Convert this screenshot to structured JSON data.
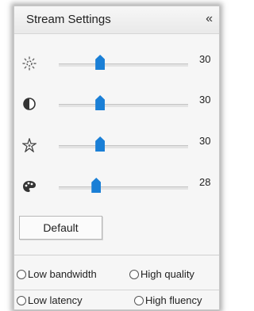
{
  "panel": {
    "title": "Stream Settings",
    "collapse_glyph": "«"
  },
  "sliders": [
    {
      "icon": "brightness-icon",
      "value": "30",
      "position": 0.32
    },
    {
      "icon": "contrast-icon",
      "value": "30",
      "position": 0.32
    },
    {
      "icon": "saturation-icon",
      "value": "30",
      "position": 0.32
    },
    {
      "icon": "color-palette-icon",
      "value": "28",
      "position": 0.29
    }
  ],
  "buttons": {
    "default_label": "Default"
  },
  "radios": {
    "low_bandwidth": "Low bandwidth",
    "high_quality": "High quality",
    "low_latency": "Low latency",
    "high_fluency": "High fluency"
  },
  "colors": {
    "accent": "#1a7fd6"
  }
}
